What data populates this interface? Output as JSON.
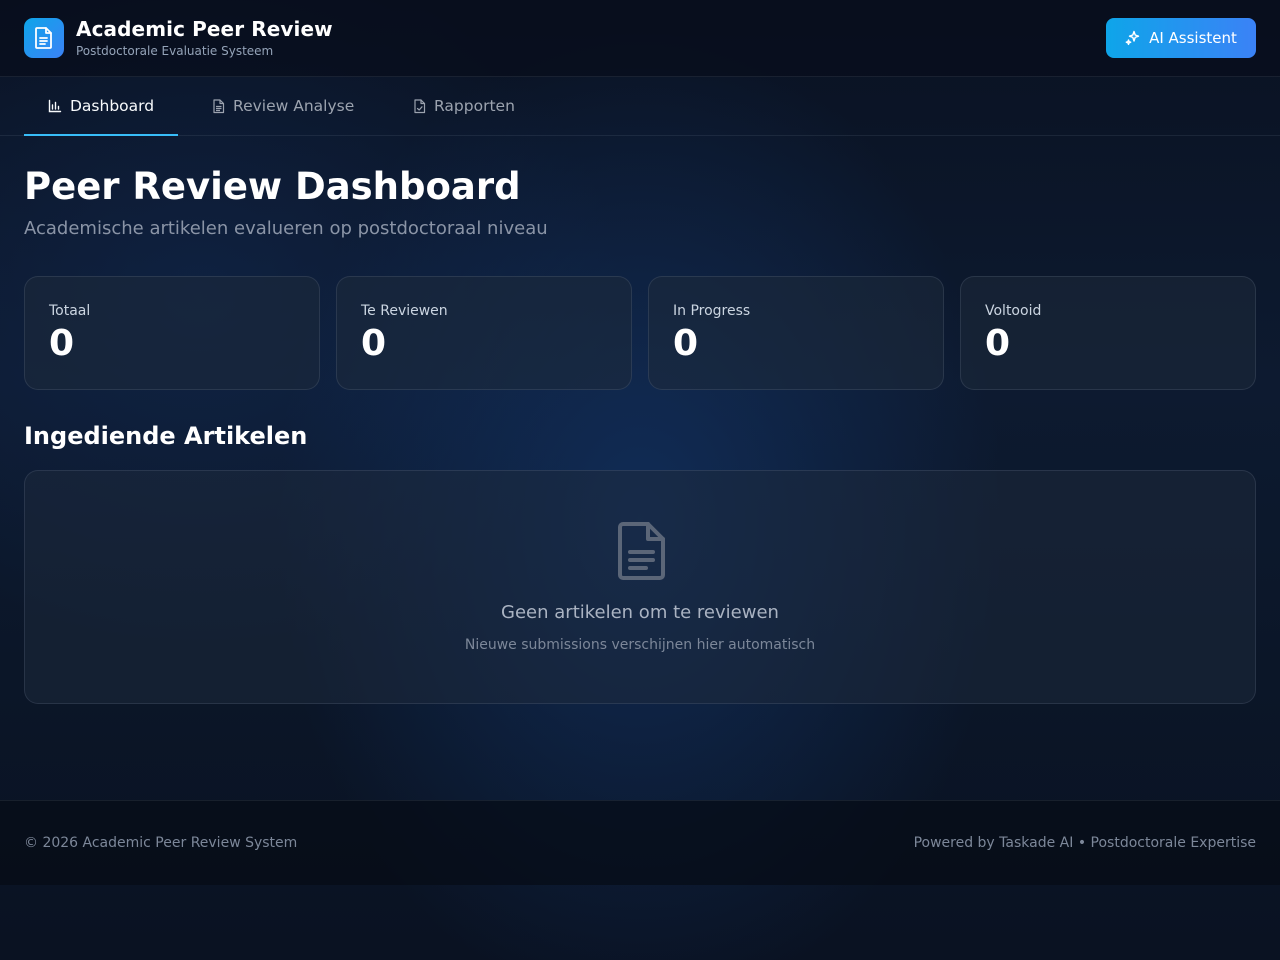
{
  "header": {
    "title": "Academic Peer Review",
    "subtitle": "Postdoctorale Evaluatie Systeem",
    "logo_icon": "document-icon",
    "ai_button_label": "AI Assistent",
    "ai_button_icon": "sparkles-icon",
    "accent_color": "#0ea5e9"
  },
  "tabs": [
    {
      "label": "Dashboard",
      "icon": "bar-chart-icon",
      "active": true
    },
    {
      "label": "Review Analyse",
      "icon": "document-icon",
      "active": false
    },
    {
      "label": "Rapporten",
      "icon": "file-check-icon",
      "active": false
    }
  ],
  "main": {
    "title": "Peer Review Dashboard",
    "subtitle": "Academische artikelen evalueren op postdoctoraal niveau",
    "stats": [
      {
        "label": "Totaal",
        "value": "0"
      },
      {
        "label": "Te Reviewen",
        "value": "0"
      },
      {
        "label": "In Progress",
        "value": "0"
      },
      {
        "label": "Voltooid",
        "value": "0"
      }
    ],
    "section_title": "Ingediende Artikelen",
    "empty_state": {
      "icon": "document-icon",
      "title": "Geen artikelen om te reviewen",
      "subtitle": "Nieuwe submissions verschijnen hier automatisch"
    }
  },
  "footer": {
    "left": "© 2026 Academic Peer Review System",
    "right": "Powered by Taskade AI • Postdoctorale Expertise"
  }
}
